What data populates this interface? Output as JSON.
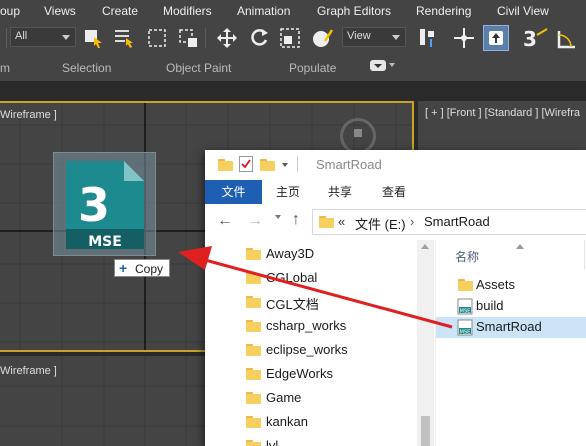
{
  "menubar": {
    "items": [
      "oup",
      "Views",
      "Create",
      "Modifiers",
      "Animation",
      "Graph Editors",
      "Rendering",
      "Civil View"
    ]
  },
  "toolbar": {
    "selection_filter": "All",
    "reference_coord": "View"
  },
  "ribbon": {
    "labels": [
      "m",
      "Selection",
      "Object Paint",
      "Populate"
    ]
  },
  "viewports": {
    "top_left_label": "Wireframe ]",
    "top_right_label": "[ + ] [Front ] [Standard ] [Wirefra",
    "bottom_left_label": "Wireframe ]"
  },
  "drag": {
    "file_icon_text": "MSE",
    "file_icon_number": "3",
    "copy_label": "Copy",
    "copy_plus": "+"
  },
  "explorer": {
    "title": "SmartRoad",
    "ribbon_tabs": [
      "文件",
      "主页",
      "共享",
      "查看"
    ],
    "address": {
      "chevron": "«",
      "drive": "文件 (E:)",
      "sep": "›",
      "folder": "SmartRoad"
    },
    "nav_items": [
      "Away3D",
      "CGLobal",
      "CGL文档",
      "csharp_works",
      "eclipse_works",
      "EdgeWorks",
      "Game",
      "kankan",
      "lvl"
    ],
    "column_header": "名称",
    "content_items": [
      {
        "name": "Assets",
        "type": "folder"
      },
      {
        "name": "build",
        "type": "mse"
      },
      {
        "name": "SmartRoad",
        "type": "mse",
        "selected": true
      }
    ]
  },
  "colors": {
    "max_ui": "#444444",
    "explorer_tab_active": "#1e5fb4",
    "arrow": "#e02020",
    "icon_teal": "#1d8a8f"
  }
}
